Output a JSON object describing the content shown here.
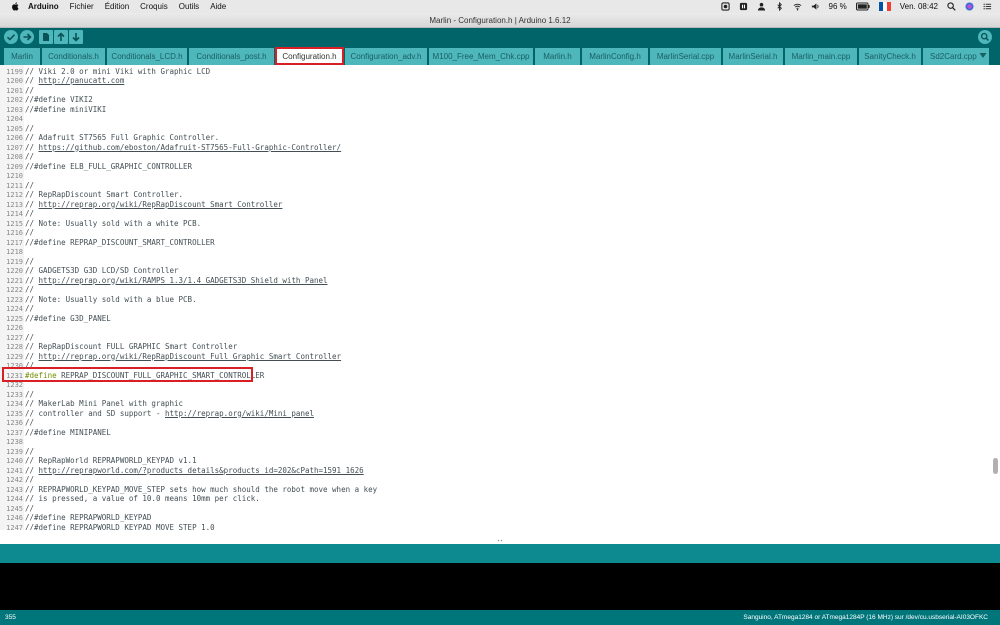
{
  "menubar": {
    "app_name": "Arduino",
    "items": [
      "Fichier",
      "Édition",
      "Croquis",
      "Outils",
      "Aide"
    ],
    "battery": "96 %",
    "clock": "Ven. 08:42"
  },
  "window": {
    "title": "Marlin - Configuration.h | Arduino 1.6.12"
  },
  "toolbar": {
    "verify_icon": "check-icon",
    "upload_icon": "arrow-right-icon",
    "new_icon": "new-file-icon",
    "open_icon": "arrow-up-icon",
    "save_icon": "arrow-down-icon",
    "serial_monitor_icon": "magnifier-icon"
  },
  "tabs": [
    {
      "label": "Marlin",
      "active": false
    },
    {
      "label": "Conditionals.h",
      "active": false
    },
    {
      "label": "Conditionals_LCD.h",
      "active": false
    },
    {
      "label": "Conditionals_post.h",
      "active": false
    },
    {
      "label": "Configuration.h",
      "active": true
    },
    {
      "label": "Configuration_adv.h",
      "active": false
    },
    {
      "label": "M100_Free_Mem_Chk.cpp",
      "active": false
    },
    {
      "label": "Marlin.h",
      "active": false
    },
    {
      "label": "MarlinConfig.h",
      "active": false
    },
    {
      "label": "MarlinSerial.cpp",
      "active": false
    },
    {
      "label": "MarlinSerial.h",
      "active": false
    },
    {
      "label": "Marlin_main.cpp",
      "active": false
    },
    {
      "label": "SanityCheck.h",
      "active": false
    },
    {
      "label": "Sd2Card.cpp",
      "active": false
    }
  ],
  "editor": {
    "lines": [
      {
        "n": "1199",
        "segments": [
          {
            "t": "// Viki 2.0 or mini Viki with Graphic LCD"
          }
        ]
      },
      {
        "n": "1200",
        "segments": [
          {
            "t": "// "
          },
          {
            "t": "http://panucatt.com",
            "link": true
          }
        ]
      },
      {
        "n": "1201",
        "segments": [
          {
            "t": "//"
          }
        ]
      },
      {
        "n": "1202",
        "segments": [
          {
            "t": "//#define VIKI2"
          }
        ]
      },
      {
        "n": "1203",
        "segments": [
          {
            "t": "//#define miniVIKI"
          }
        ]
      },
      {
        "n": "1204",
        "segments": []
      },
      {
        "n": "1205",
        "segments": [
          {
            "t": "//"
          }
        ]
      },
      {
        "n": "1206",
        "segments": [
          {
            "t": "// Adafruit ST7565 Full Graphic Controller."
          }
        ]
      },
      {
        "n": "1207",
        "segments": [
          {
            "t": "// "
          },
          {
            "t": "https://github.com/eboston/Adafruit-ST7565-Full-Graphic-Controller/",
            "link": true
          }
        ]
      },
      {
        "n": "1208",
        "segments": [
          {
            "t": "//"
          }
        ]
      },
      {
        "n": "1209",
        "segments": [
          {
            "t": "//#define ELB_FULL_GRAPHIC_CONTROLLER"
          }
        ]
      },
      {
        "n": "1210",
        "segments": []
      },
      {
        "n": "1211",
        "segments": [
          {
            "t": "//"
          }
        ]
      },
      {
        "n": "1212",
        "segments": [
          {
            "t": "// RepRapDiscount Smart Controller."
          }
        ]
      },
      {
        "n": "1213",
        "segments": [
          {
            "t": "// "
          },
          {
            "t": "http://reprap.org/wiki/RepRapDiscount_Smart_Controller",
            "link": true
          }
        ]
      },
      {
        "n": "1214",
        "segments": [
          {
            "t": "//"
          }
        ]
      },
      {
        "n": "1215",
        "segments": [
          {
            "t": "// Note: Usually sold with a white PCB."
          }
        ]
      },
      {
        "n": "1216",
        "segments": [
          {
            "t": "//"
          }
        ]
      },
      {
        "n": "1217",
        "segments": [
          {
            "t": "//#define REPRAP_DISCOUNT_SMART_CONTROLLER"
          }
        ]
      },
      {
        "n": "1218",
        "segments": []
      },
      {
        "n": "1219",
        "segments": [
          {
            "t": "//"
          }
        ]
      },
      {
        "n": "1220",
        "segments": [
          {
            "t": "// GADGETS3D G3D LCD/SD Controller"
          }
        ]
      },
      {
        "n": "1221",
        "segments": [
          {
            "t": "// "
          },
          {
            "t": "http://reprap.org/wiki/RAMPS_1.3/1.4_GADGETS3D_Shield_with_Panel",
            "link": true
          }
        ]
      },
      {
        "n": "1222",
        "segments": [
          {
            "t": "//"
          }
        ]
      },
      {
        "n": "1223",
        "segments": [
          {
            "t": "// Note: Usually sold with a blue PCB."
          }
        ]
      },
      {
        "n": "1224",
        "segments": [
          {
            "t": "//"
          }
        ]
      },
      {
        "n": "1225",
        "segments": [
          {
            "t": "//#define G3D_PANEL"
          }
        ]
      },
      {
        "n": "1226",
        "segments": []
      },
      {
        "n": "1227",
        "segments": [
          {
            "t": "//"
          }
        ]
      },
      {
        "n": "1228",
        "segments": [
          {
            "t": "// RepRapDiscount FULL GRAPHIC Smart Controller"
          }
        ]
      },
      {
        "n": "1229",
        "segments": [
          {
            "t": "// "
          },
          {
            "t": "http://reprap.org/wiki/RepRapDiscount_Full_Graphic_Smart_Controller",
            "link": true
          }
        ]
      },
      {
        "n": "1230",
        "segments": [
          {
            "t": "//"
          }
        ]
      },
      {
        "n": "1231",
        "segments": [
          {
            "t": "#define",
            "kw": true
          },
          {
            "t": " REPRAP_DISCOUNT_FULL_GRAPHIC_SMART_CONTROLLER"
          }
        ]
      },
      {
        "n": "1232",
        "segments": []
      },
      {
        "n": "1233",
        "segments": [
          {
            "t": "//"
          }
        ]
      },
      {
        "n": "1234",
        "segments": [
          {
            "t": "// MakerLab Mini Panel with graphic"
          }
        ]
      },
      {
        "n": "1235",
        "segments": [
          {
            "t": "// controller and SD support - "
          },
          {
            "t": "http://reprap.org/wiki/Mini_panel",
            "link": true
          }
        ]
      },
      {
        "n": "1236",
        "segments": [
          {
            "t": "//"
          }
        ]
      },
      {
        "n": "1237",
        "segments": [
          {
            "t": "//#define MINIPANEL"
          }
        ]
      },
      {
        "n": "1238",
        "segments": []
      },
      {
        "n": "1239",
        "segments": [
          {
            "t": "//"
          }
        ]
      },
      {
        "n": "1240",
        "segments": [
          {
            "t": "// RepRapWorld REPRAPWORLD_KEYPAD v1.1"
          }
        ]
      },
      {
        "n": "1241",
        "segments": [
          {
            "t": "// "
          },
          {
            "t": "http://reprapworld.com/?products_details&products_id=202&cPath=1591_1626",
            "link": true
          }
        ]
      },
      {
        "n": "1242",
        "segments": [
          {
            "t": "//"
          }
        ]
      },
      {
        "n": "1243",
        "segments": [
          {
            "t": "// REPRAPWORLD_KEYPAD_MOVE_STEP sets how much should the robot move when a key"
          }
        ]
      },
      {
        "n": "1244",
        "segments": [
          {
            "t": "// is pressed, a value of 10.0 means 10mm per click."
          }
        ]
      },
      {
        "n": "1245",
        "segments": [
          {
            "t": "//"
          }
        ]
      },
      {
        "n": "1246",
        "segments": [
          {
            "t": "//#define REPRAPWORLD_KEYPAD"
          }
        ]
      },
      {
        "n": "1247",
        "segments": [
          {
            "t": "//#define REPRAPWORLD_KEYPAD_MOVE_STEP 1.0"
          }
        ]
      }
    ]
  },
  "status": {
    "line_number": "355",
    "board": "Sanguino, ATmega1284 or ATmega1284P (16 MHz) sur /dev/cu.usbserial-AI03OFKC"
  },
  "colors": {
    "toolbar_bg": "#006468",
    "tab_bg": "#4db7bb",
    "highlight_frame": "#d81f26",
    "status_bg": "#00767b"
  }
}
